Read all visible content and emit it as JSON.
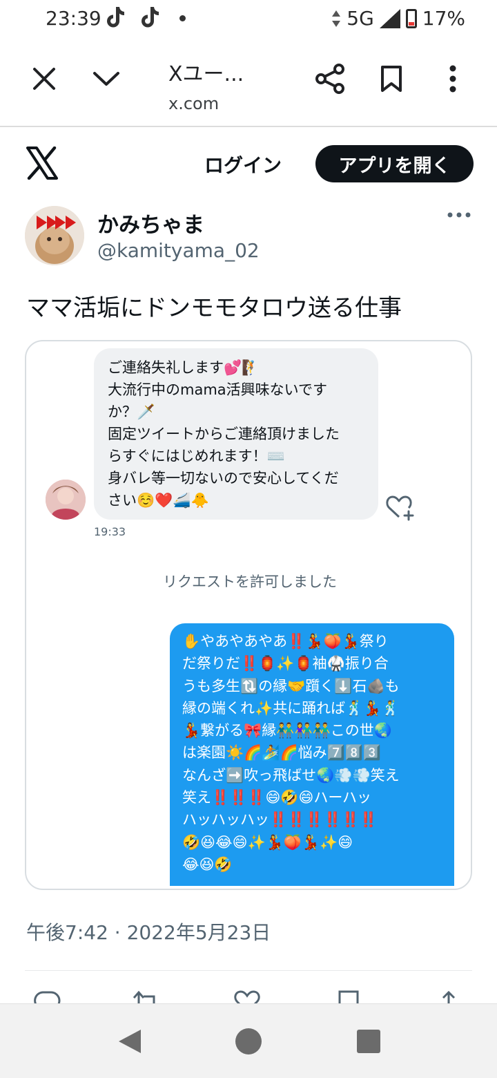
{
  "status_bar": {
    "time": "23:39",
    "network": "5G",
    "battery": "17%",
    "icons": [
      "tiktok-icon",
      "tiktok-icon",
      "dot-icon",
      "data-arrows-icon",
      "signal-icon",
      "battery-icon"
    ]
  },
  "browser": {
    "title": "Xユー...",
    "url": "x.com",
    "icons": [
      "close-icon",
      "chevron-down-icon",
      "share-icon",
      "bookmark-icon",
      "more-vertical-icon"
    ]
  },
  "x_header": {
    "logo": "x-logo",
    "login_label": "ログイン",
    "open_app_label": "アプリを開く"
  },
  "tweet": {
    "author_name": "かみちゃま",
    "author_handle": "@kamityama_02",
    "text": "ママ活垢にドンモモタロウ送る仕事",
    "timestamp": "午後7:42 · 2022年5月23日"
  },
  "dm": {
    "incoming_lines": [
      "ご連絡失礼します💕🧗",
      "大流行中のmama活興味ないです",
      "か？🗡️",
      "固定ツイートからご連絡頂けました",
      "らすぐにはじめれます！⌨️",
      "身バレ等一切ないので安心してくだ",
      "さい☺️❤️🚄🐥"
    ],
    "incoming_time": "19:33",
    "notice": "リクエストを許可しました",
    "outgoing_lines": [
      "✋やあやあやあ‼️💃🍑💃祭り",
      "だ祭りだ‼️🏮✨🏮袖🥋振り合",
      "うも多生🔃の縁🤝躓く⬇️石🪨も",
      "縁の端くれ✨共に踊れば🕺💃🕺",
      "💃繋がる🎀縁👬👫👬この世🌏",
      "は楽園☀️🌈🏄🌈悩み7️⃣8️⃣3️⃣",
      "なんざ➡️吹っ飛ばせ🌏💨💨笑え",
      "笑え‼️‼️‼️😄🤣😄ハーハッ",
      "ハッハッハッ‼️‼️‼️‼️‼️‼️",
      "🤣😆😂😄✨💃🍑💃✨😄",
      "😂😆🤣"
    ]
  },
  "actions": {
    "icons": [
      "reply-icon",
      "retweet-icon",
      "like-icon",
      "bookmark-icon",
      "share-icon"
    ]
  },
  "nav": {
    "icons": [
      "back-triangle-icon",
      "home-circle-icon",
      "recents-square-icon"
    ]
  },
  "colors": {
    "accent": "#1d9bf0",
    "text": "#0f1419",
    "muted": "#536471",
    "battery_low": "#e53935"
  }
}
